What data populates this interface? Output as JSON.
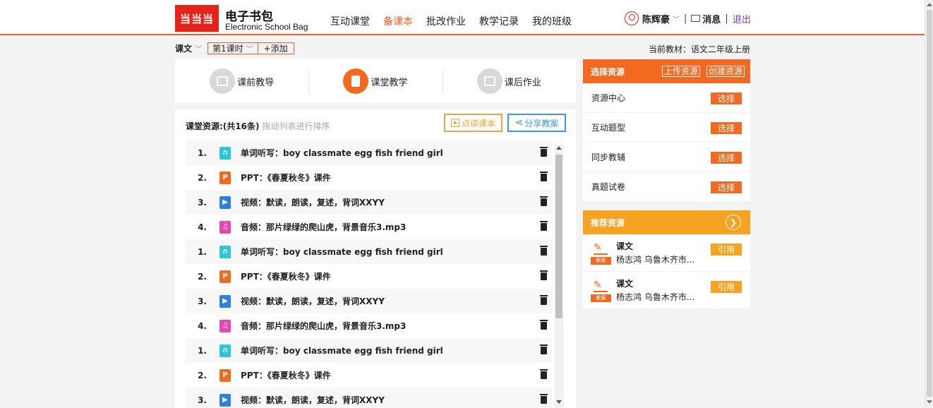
{
  "header": {
    "logo_text": "当当当",
    "brand_cn": "电子书包",
    "brand_en": "Electronic School Bag",
    "nav": [
      {
        "label": "互动课堂",
        "active": false
      },
      {
        "label": "备课本",
        "active": true
      },
      {
        "label": "批改作业",
        "active": false
      },
      {
        "label": "教学记录",
        "active": false
      },
      {
        "label": "我的班级",
        "active": false
      }
    ],
    "user_name": "陈辉豪",
    "separator": "|",
    "messages_label": "消息",
    "logout_label": "退出"
  },
  "subbar": {
    "type_label": "课文",
    "lesson_label": "第1课时",
    "add_label": "+添加",
    "current_book": "当前教材：语文二年级上册"
  },
  "tabs": [
    {
      "label": "课前教导",
      "active": false
    },
    {
      "label": "课堂教学",
      "active": true
    },
    {
      "label": "课后作业",
      "active": false
    }
  ],
  "resources": {
    "title": "课堂资源:(共16条)",
    "hint": "拖动列表进行排序",
    "read_button": "点读课本",
    "share_button": "分享教案",
    "items": [
      {
        "num": "1.",
        "type": "listen",
        "text": "单词听写：boy classmate egg fish friend girl"
      },
      {
        "num": "2.",
        "type": "ppt",
        "text": "PPT：《春夏秋冬》课件"
      },
      {
        "num": "3.",
        "type": "video",
        "text": "视频：默读，朗读，复述，背词XXYY"
      },
      {
        "num": "4.",
        "type": "audio",
        "text": "音频：那片绿绿的爬山虎，背景音乐3.mp3"
      },
      {
        "num": "1.",
        "type": "listen",
        "text": "单词听写：boy classmate egg fish friend girl"
      },
      {
        "num": "2.",
        "type": "ppt",
        "text": "PPT：《春夏秋冬》课件"
      },
      {
        "num": "3.",
        "type": "video",
        "text": "视频：默读，朗读，复述，背词XXYY"
      },
      {
        "num": "4.",
        "type": "audio",
        "text": "音频：那片绿绿的爬山虎，背景音乐3.mp3"
      },
      {
        "num": "1.",
        "type": "listen",
        "text": "单词听写：boy classmate egg fish friend girl"
      },
      {
        "num": "2.",
        "type": "ppt",
        "text": "PPT：《春夏秋冬》课件"
      },
      {
        "num": "3.",
        "type": "video",
        "text": "视频：默读，朗读，复述，背词XXYY"
      }
    ]
  },
  "pick": {
    "title": "选择资源",
    "upload_label": "上传资源",
    "create_label": "创建资源",
    "select_label": "选择",
    "items": [
      "资源中心",
      "互动题型",
      "同步教辅",
      "真题试卷"
    ]
  },
  "recommend": {
    "title": "推荐资源",
    "cite_label": "引用",
    "icon_tag": "教案",
    "items": [
      {
        "title": "课文",
        "author": "杨志鸿 乌鲁木齐市..."
      },
      {
        "title": "课文",
        "author": "杨志鸿 乌鲁木齐市..."
      }
    ]
  },
  "colors": {
    "accent": "#e8632c",
    "logo_red": "#e5231b",
    "recommend_orange": "#f7a322",
    "share_blue": "#3b9be0"
  }
}
